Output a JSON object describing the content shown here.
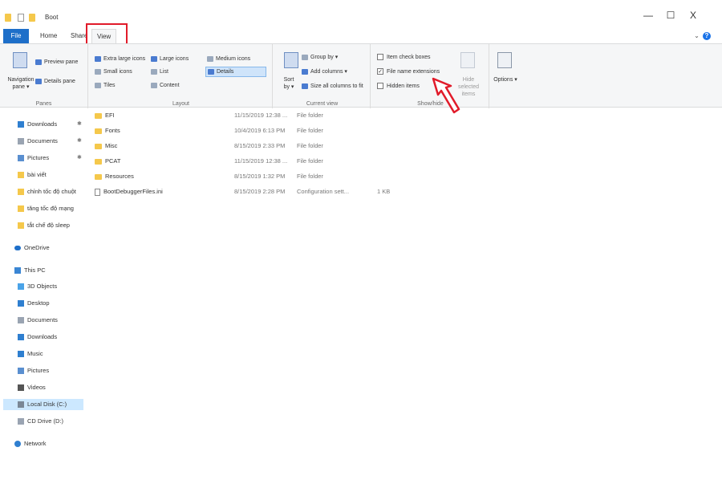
{
  "window": {
    "title": "Boot",
    "minimize": "—",
    "maximize": "☐",
    "close": "X",
    "help_chevron": "⌄",
    "help_icon": "?"
  },
  "tabs": {
    "file": "File",
    "home": "Home",
    "share": "Share",
    "view": "View"
  },
  "ribbon": {
    "panes": {
      "label": "Panes",
      "navigation_pane": "Navigation pane ▾",
      "preview_pane": "Preview pane",
      "details_pane": "Details pane"
    },
    "layout": {
      "label": "Layout",
      "extra_large_icons": "Extra large icons",
      "large_icons": "Large icons",
      "medium_icons": "Medium icons",
      "small_icons": "Small icons",
      "list": "List",
      "details": "Details",
      "tiles": "Tiles",
      "content": "Content"
    },
    "current_view": {
      "label": "Current view",
      "sort_by": "Sort by ▾",
      "group_by": "Group by ▾",
      "add_columns": "Add columns ▾",
      "size_all_columns": "Size all columns to fit"
    },
    "show_hide": {
      "label": "Show/hide",
      "item_check_boxes": "Item check boxes",
      "file_name_extensions": "File name extensions",
      "hidden_items": "Hidden items",
      "hide_selected_items": "Hide selected items"
    },
    "options": {
      "label": "Options ▾"
    }
  },
  "sidebar": {
    "quick_access": [
      {
        "label": "Downloads",
        "pinned": true,
        "icon": "download-arrow-icon"
      },
      {
        "label": "Documents",
        "pinned": true,
        "icon": "document-icon"
      },
      {
        "label": "Pictures",
        "pinned": true,
        "icon": "picture-icon"
      },
      {
        "label": "bài viết",
        "pinned": false,
        "icon": "folder-icon"
      },
      {
        "label": "chỉnh tốc độ chuột",
        "pinned": false,
        "icon": "folder-icon"
      },
      {
        "label": "tăng tốc độ mạng",
        "pinned": false,
        "icon": "folder-icon"
      },
      {
        "label": "tắt chế độ sleep",
        "pinned": false,
        "icon": "folder-icon"
      }
    ],
    "onedrive": "OneDrive",
    "this_pc": "This PC",
    "pc_items": [
      {
        "label": "3D Objects",
        "icon": "cube-icon"
      },
      {
        "label": "Desktop",
        "icon": "desktop-icon"
      },
      {
        "label": "Documents",
        "icon": "document-icon"
      },
      {
        "label": "Downloads",
        "icon": "download-arrow-icon"
      },
      {
        "label": "Music",
        "icon": "music-icon"
      },
      {
        "label": "Pictures",
        "icon": "picture-icon"
      },
      {
        "label": "Videos",
        "icon": "video-icon"
      },
      {
        "label": "Local Disk (C:)",
        "icon": "drive-icon",
        "selected": true
      },
      {
        "label": "CD Drive (D:)",
        "icon": "cd-drive-icon"
      }
    ],
    "network": "Network",
    "pin_glyph": "✱"
  },
  "files": [
    {
      "name": "EFI",
      "date": "11/15/2019 12:38 ...",
      "type": "File folder",
      "size": "",
      "kind": "folder"
    },
    {
      "name": "Fonts",
      "date": "10/4/2019 6:13 PM",
      "type": "File folder",
      "size": "",
      "kind": "folder"
    },
    {
      "name": "Misc",
      "date": "8/15/2019 2:33 PM",
      "type": "File folder",
      "size": "",
      "kind": "folder"
    },
    {
      "name": "PCAT",
      "date": "11/15/2019 12:38 ...",
      "type": "File folder",
      "size": "",
      "kind": "folder"
    },
    {
      "name": "Resources",
      "date": "8/15/2019 1:32 PM",
      "type": "File folder",
      "size": "",
      "kind": "folder"
    },
    {
      "name": "BootDebuggerFiles.ini",
      "date": "8/15/2019 2:28 PM",
      "type": "Configuration sett...",
      "size": "1 KB",
      "kind": "file"
    }
  ],
  "colors": {
    "file_tab": "#1e6fc9",
    "highlight": "#e11b2a",
    "folder": "#f5c84b",
    "selection": "#cce8ff"
  }
}
